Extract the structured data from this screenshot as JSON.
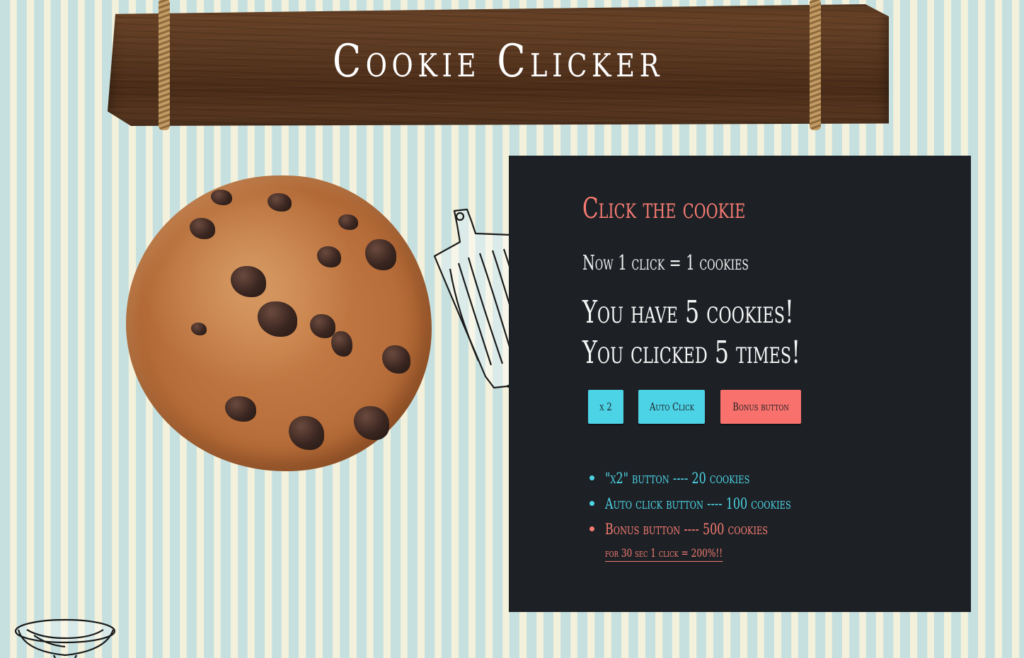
{
  "header": {
    "title": "Cookie Clicker"
  },
  "panel": {
    "heading": "Click the cookie",
    "rate_text": "Now 1 click = 1 cookies",
    "cookies_text": "You have 5 cookies!",
    "clicks_text": "You clicked 5 times!",
    "buttons": {
      "x2_label": "x 2",
      "auto_label": "Auto Click",
      "bonus_label": "Bonus button"
    },
    "prices": [
      "\"x2\" button ---- 20 cookies",
      "Auto click button ---- 100 cookies",
      "Bonus button ---- 500 cookies"
    ],
    "bonus_note": "for 30 sec 1 click = 200%!!"
  },
  "colors": {
    "accent_cyan": "#4dd3e6",
    "accent_coral": "#f77b72",
    "panel_bg": "#1d2125"
  },
  "icons": {
    "cookie": "cookie-image",
    "board": "cutting-board-sketch",
    "bowl": "bowl-sketch"
  }
}
